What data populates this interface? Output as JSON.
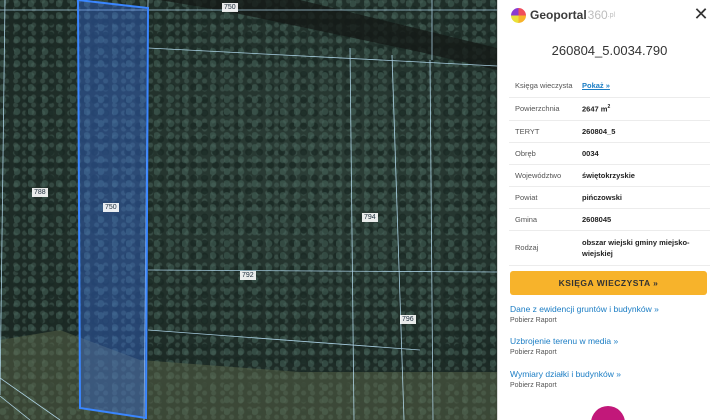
{
  "map": {
    "plot_labels": [
      "750",
      "788",
      "750",
      "794",
      "792",
      "796"
    ]
  },
  "panel": {
    "logo": {
      "main": "Geoportal",
      "num": "360",
      "suffix": ".pl"
    },
    "close_icon": "close-icon",
    "plot_id": "260804_5.0034.790",
    "properties": [
      {
        "key": "Księga wieczysta",
        "value": "Pokaż »",
        "link": true
      },
      {
        "key": "Powierzchnia",
        "value": "2647 m",
        "unit_sup": "2"
      },
      {
        "key": "TERYT",
        "value": "260804_5"
      },
      {
        "key": "Obręb",
        "value": "0034"
      },
      {
        "key": "Województwo",
        "value": "świętokrzyskie"
      },
      {
        "key": "Powiat",
        "value": "pińczowski"
      },
      {
        "key": "Gmina",
        "value": "2608045"
      },
      {
        "key": "Rodzaj",
        "value": "obszar wiejski gminy miejsko-wiejskiej"
      }
    ],
    "kw_button": "KSIĘGA WIECZYSTA »",
    "reports": [
      {
        "title": "Dane z ewidencji gruntów i budynków »",
        "sub": "Pobierz Raport"
      },
      {
        "title": "Uzbrojenie terenu w media »",
        "sub": "Pobierz Raport"
      },
      {
        "title": "Wymiary działki i budynków »",
        "sub": "Pobierz Raport"
      }
    ],
    "colors": {
      "accent": "#f7b32b",
      "link": "#1b7dc4",
      "fab": "#c2187a"
    }
  }
}
